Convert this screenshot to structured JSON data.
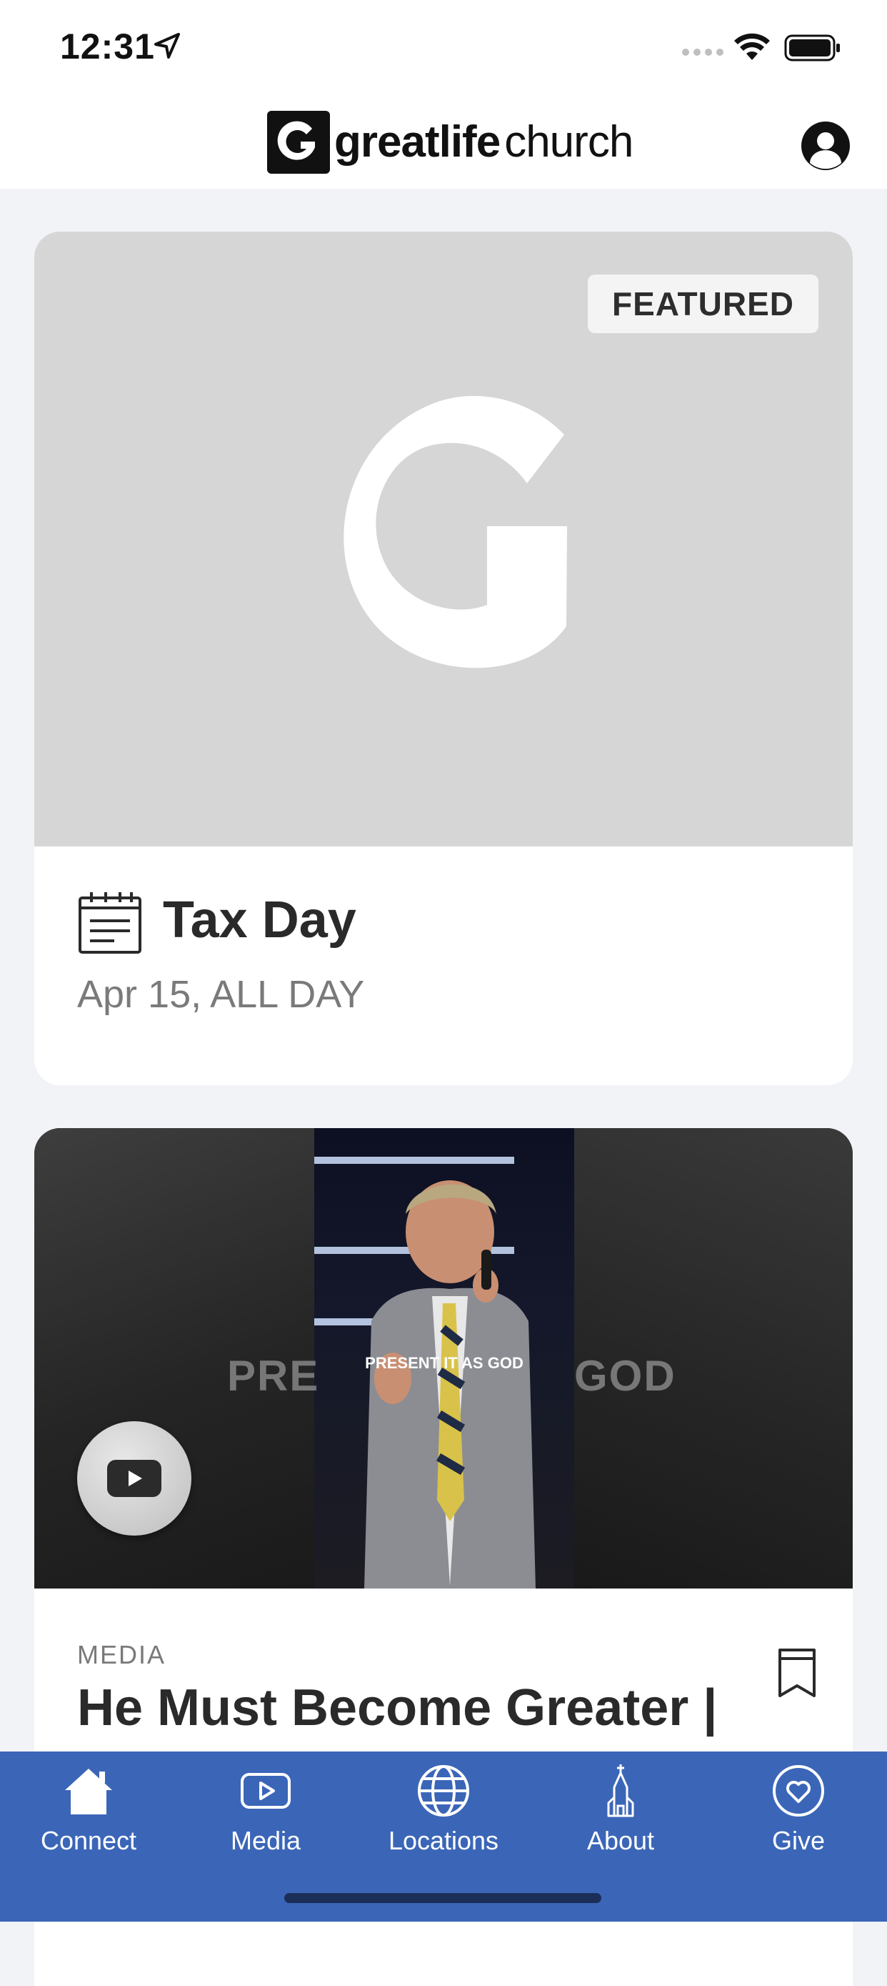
{
  "status_bar": {
    "time": "12:31"
  },
  "header": {
    "logo_text_bold": "greatlife",
    "logo_text_light": "church"
  },
  "featured_card": {
    "badge": "FEATURED",
    "title": "Tax Day",
    "date": "Apr 15, ALL DAY"
  },
  "media_card": {
    "video_caption_left": "PRE",
    "video_caption_center": "PRESENT IT AS GOD",
    "video_caption_right": "GOD",
    "label": "MEDIA",
    "title": "He Must Become Greater |"
  },
  "tabs": [
    {
      "label": "Connect",
      "icon": "home-icon"
    },
    {
      "label": "Media",
      "icon": "play-icon"
    },
    {
      "label": "Locations",
      "icon": "globe-icon"
    },
    {
      "label": "About",
      "icon": "church-icon"
    },
    {
      "label": "Give",
      "icon": "heart-icon"
    }
  ],
  "colors": {
    "tabbar": "#3b66b8",
    "background": "#f2f3f7",
    "image_placeholder": "#d6d6d6"
  }
}
